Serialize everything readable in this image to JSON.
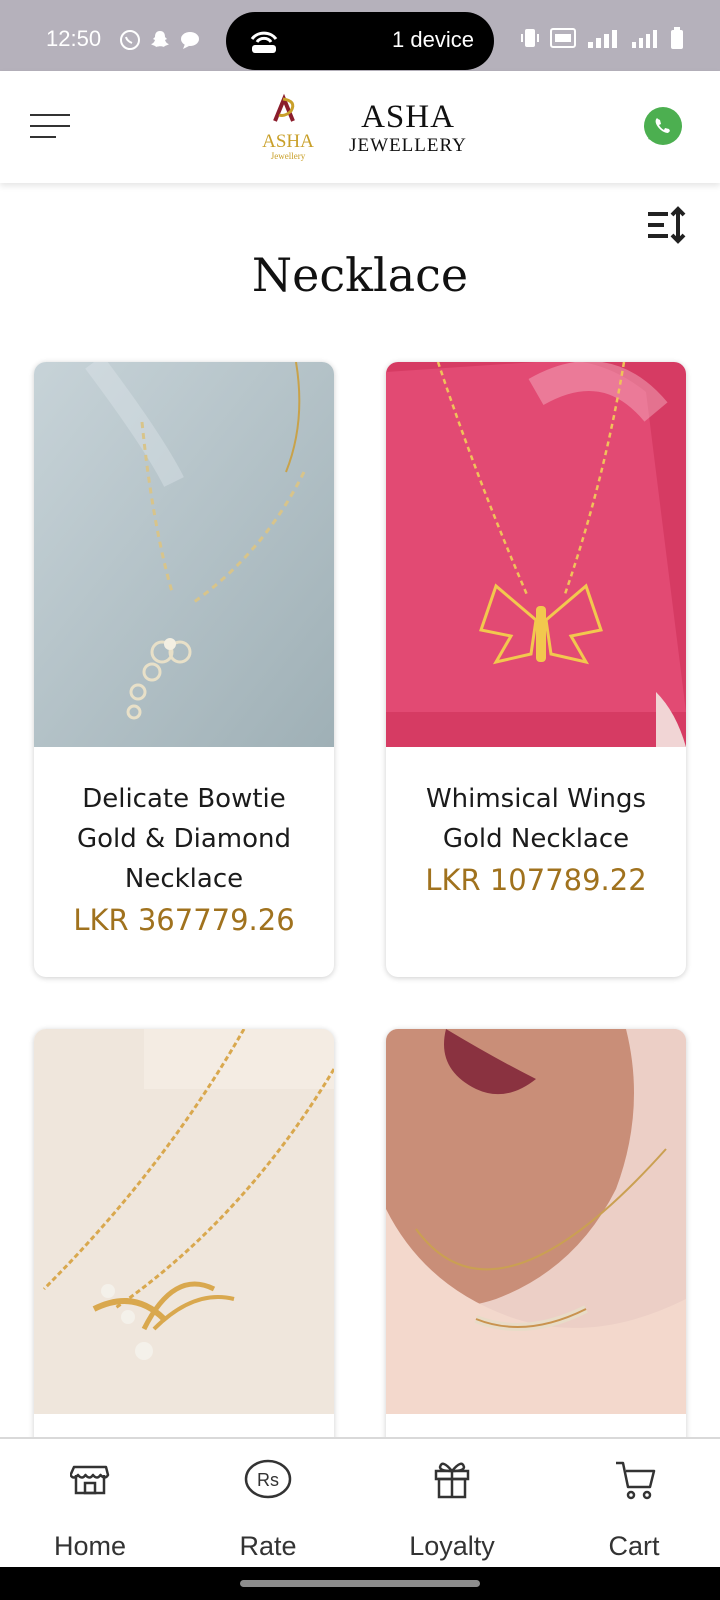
{
  "status_bar": {
    "time": "12:50",
    "hotspot_label": "1 device",
    "network": "4G"
  },
  "header": {
    "brand_name": "ASHA",
    "brand_sub": "JEWELLERY",
    "logo_text": "ASHA",
    "logo_sub": "Jewellery"
  },
  "page": {
    "title": "Necklace"
  },
  "products": [
    {
      "name": "Delicate Bowtie Gold & Diamond Necklace",
      "price": "LKR 367779.26"
    },
    {
      "name": "Whimsical Wings Gold Necklace",
      "price": "LKR 107789.22"
    },
    {
      "name": "",
      "price": ""
    },
    {
      "name": "",
      "price": ""
    }
  ],
  "bottom_nav": {
    "items": [
      {
        "label": "Home",
        "icon": "store-icon"
      },
      {
        "label": "Rate",
        "icon": "rupee-badge-icon"
      },
      {
        "label": "Loyalty",
        "icon": "gift-icon"
      },
      {
        "label": "Cart",
        "icon": "cart-icon"
      }
    ]
  },
  "colors": {
    "accent_price": "#a0721e",
    "whatsapp": "#4caf50",
    "status_bar": "#b5b1bb"
  }
}
